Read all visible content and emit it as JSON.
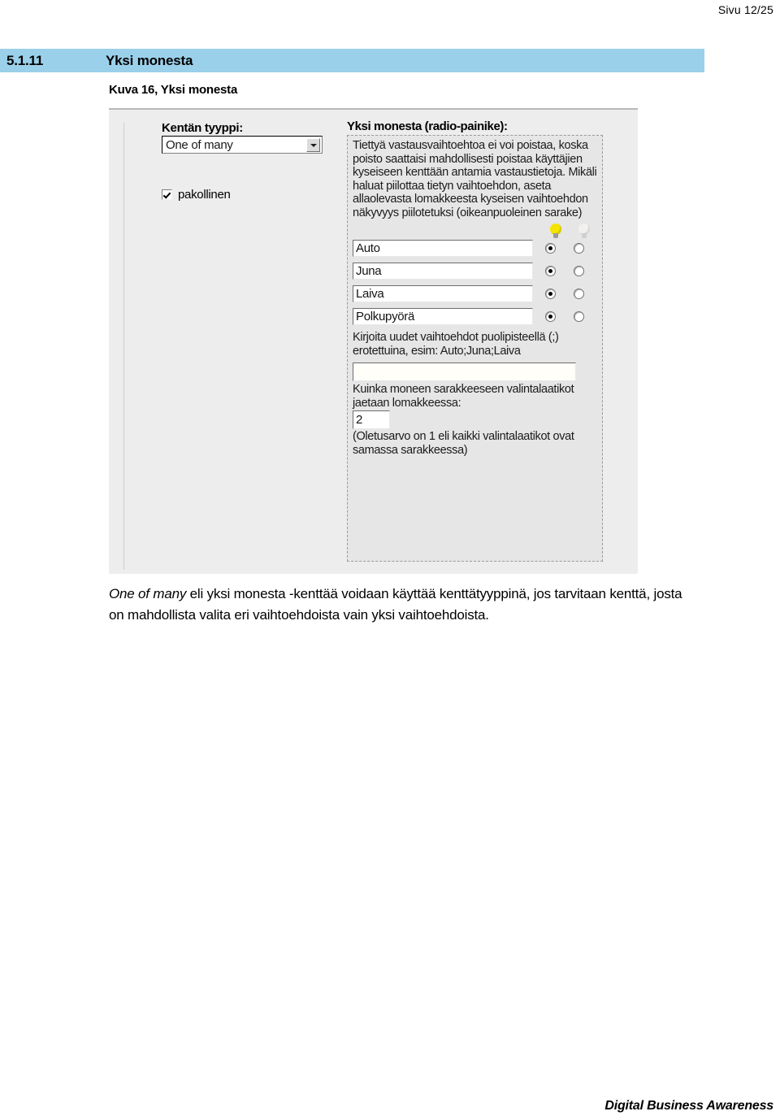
{
  "page": {
    "page_label": "Sivu 12/25",
    "footer": "Digital Business Awareness"
  },
  "heading": {
    "number": "5.1.11",
    "title": "Yksi monesta"
  },
  "figure": {
    "caption": "Kuva 16, Yksi monesta"
  },
  "form": {
    "left": {
      "field_type_label": "Kentän tyyppi:",
      "field_type_value": "One of many",
      "dropdown_icon": "chevron-down-icon",
      "required_checkbox_label": "pakollinen",
      "required_checkbox_checked": true
    },
    "right": {
      "group_title": "Yksi monesta (radio-painike):",
      "help_text": "Tiettyä vastausvaihtoehtoa ei voi poistaa, koska poisto saattaisi mahdollisesti poistaa käyttäjien kyseiseen kenttään antamia vastaustietoja. Mikäli haluat piilottaa tietyn vaihtoehdon, aseta allaolevasta lomakkeesta kyseisen vaihtoehdon näkyvyys piilotetuksi (oikeanpuoleinen sarake)",
      "visibility_header": {
        "visible_icon": "lightbulb-on-icon",
        "hidden_icon": "lightbulb-off-icon"
      },
      "options": [
        {
          "value": "Auto",
          "visible_selected": true,
          "hidden_selected": false
        },
        {
          "value": "Juna",
          "visible_selected": true,
          "hidden_selected": false
        },
        {
          "value": "Laiva",
          "visible_selected": true,
          "hidden_selected": false
        },
        {
          "value": "Polkupyörä",
          "visible_selected": true,
          "hidden_selected": false
        }
      ],
      "new_options_help": "Kirjoita uudet vaihtoehdot puolipisteellä (;) erotettuina, esim: Auto;Juna;Laiva",
      "new_options_value": "",
      "columns_label": "Kuinka moneen sarakkeeseen valintalaatikot jaetaan lomakkeessa:",
      "columns_value": "2",
      "columns_note": "(Oletusarvo on 1 eli kaikki valintalaatikot ovat samassa sarakkeessa)"
    }
  },
  "body": {
    "emphasis": "One of many",
    "paragraph": " eli yksi monesta -kenttää voidaan käyttää kenttätyyppinä, jos tarvitaan kenttä, josta on mahdollista valita eri vaihtoehdoista vain yksi vaihtoehdoista."
  },
  "colors": {
    "heading_band": "#9bd0ea",
    "bulb_on": "#f5e400",
    "bulb_off": "#f2f0ef"
  }
}
